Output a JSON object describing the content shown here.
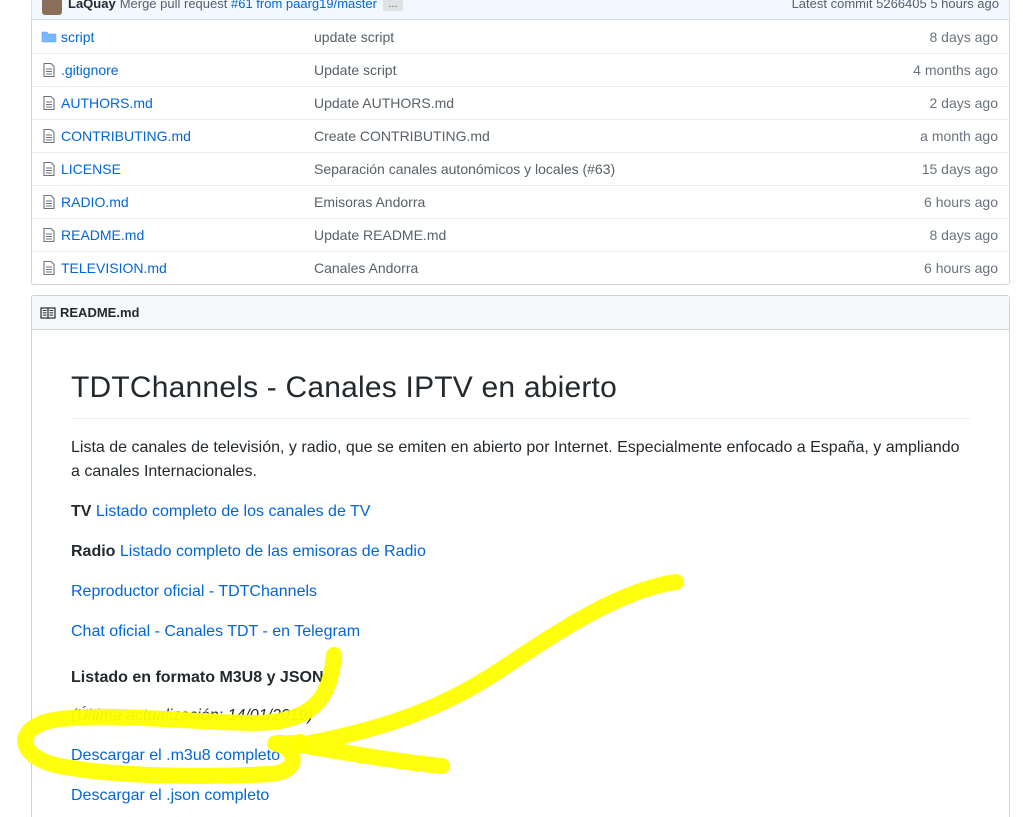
{
  "commit_bar": {
    "author": "LaQuay",
    "message": "Merge pull request",
    "pr_link": "#61 from paarg19/master",
    "ellipsis": "…",
    "latest": "Latest commit 5266405 5 hours ago"
  },
  "files": [
    {
      "type": "folder",
      "name": "script",
      "message": "update script",
      "age": "8 days ago"
    },
    {
      "type": "file",
      "name": ".gitignore",
      "message": "Update script",
      "age": "4 months ago"
    },
    {
      "type": "file",
      "name": "AUTHORS.md",
      "message": "Update AUTHORS.md",
      "age": "2 days ago"
    },
    {
      "type": "file",
      "name": "CONTRIBUTING.md",
      "message": "Create CONTRIBUTING.md",
      "age": "a month ago"
    },
    {
      "type": "file",
      "name": "LICENSE",
      "message": "Separación canales autonómicos y locales (#63)",
      "age": "15 days ago"
    },
    {
      "type": "file",
      "name": "RADIO.md",
      "message": "Emisoras Andorra",
      "age": "6 hours ago"
    },
    {
      "type": "file",
      "name": "README.md",
      "message": "Update README.md",
      "age": "8 days ago"
    },
    {
      "type": "file",
      "name": "TELEVISION.md",
      "message": "Canales Andorra",
      "age": "6 hours ago"
    }
  ],
  "readme": {
    "header": "README.md",
    "title": "TDTChannels - Canales IPTV en abierto",
    "intro": "Lista de canales de televisión, y radio, que se emiten en abierto por Internet. Especialmente enfocado a España, y ampliando a canales Internacionales.",
    "tv_label": "TV",
    "tv_link": "Listado completo de los canales de TV",
    "radio_label": "Radio",
    "radio_link": "Listado completo de las emisoras de Radio",
    "player_link": "Reproductor oficial - TDTChannels",
    "chat_link": "Chat oficial - Canales TDT - en Telegram",
    "format_heading": "Listado en formato M3U8 y JSON",
    "last_update": "(Última actualización: 14/01/2019)",
    "m3u8_link": "Descargar el .m3u8 completo",
    "json_link": "Descargar el .json completo"
  },
  "colors": {
    "link": "#0366d6",
    "highlight": "#ffff00"
  }
}
